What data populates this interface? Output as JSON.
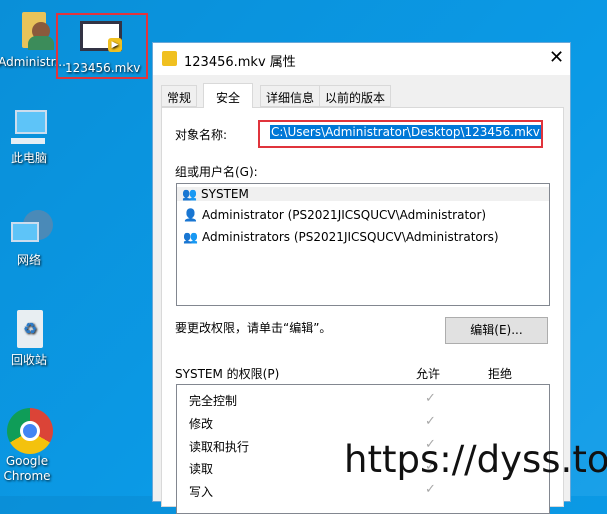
{
  "desktop": {
    "icons": [
      {
        "label": "Administr..."
      },
      {
        "label": "123456.mkv"
      },
      {
        "label": "此电脑"
      },
      {
        "label": "网络"
      },
      {
        "label": "回收站"
      },
      {
        "label": "Google Chrome"
      }
    ]
  },
  "dialog": {
    "title": "123456.mkv 属性",
    "tabs": [
      "常规",
      "安全",
      "详细信息",
      "以前的版本"
    ],
    "active_tab": "安全",
    "object_label": "对象名称:",
    "object_value": "C:\\Users\\Administrator\\Desktop\\123456.mkv",
    "groups_label": "组或用户名(G):",
    "groups": [
      "SYSTEM",
      "Administrator (PS2021JICSQUCV\\Administrator)",
      "Administrators (PS2021JICSQUCV\\Administrators)"
    ],
    "edit_hint": "要更改权限，请单击“编辑”。",
    "edit_button": "编辑(E)...",
    "perm_label": "SYSTEM 的权限(P)",
    "allow": "允许",
    "deny": "拒绝",
    "permissions": [
      {
        "name": "完全控制",
        "allow": true
      },
      {
        "name": "修改",
        "allow": true
      },
      {
        "name": "读取和执行",
        "allow": true
      },
      {
        "name": "读取",
        "allow": true
      },
      {
        "name": "写入",
        "allow": true
      }
    ]
  },
  "watermark": "https://dyss.top",
  "colors": {
    "highlight_border": "#e0343c",
    "selection": "#0078d7"
  }
}
